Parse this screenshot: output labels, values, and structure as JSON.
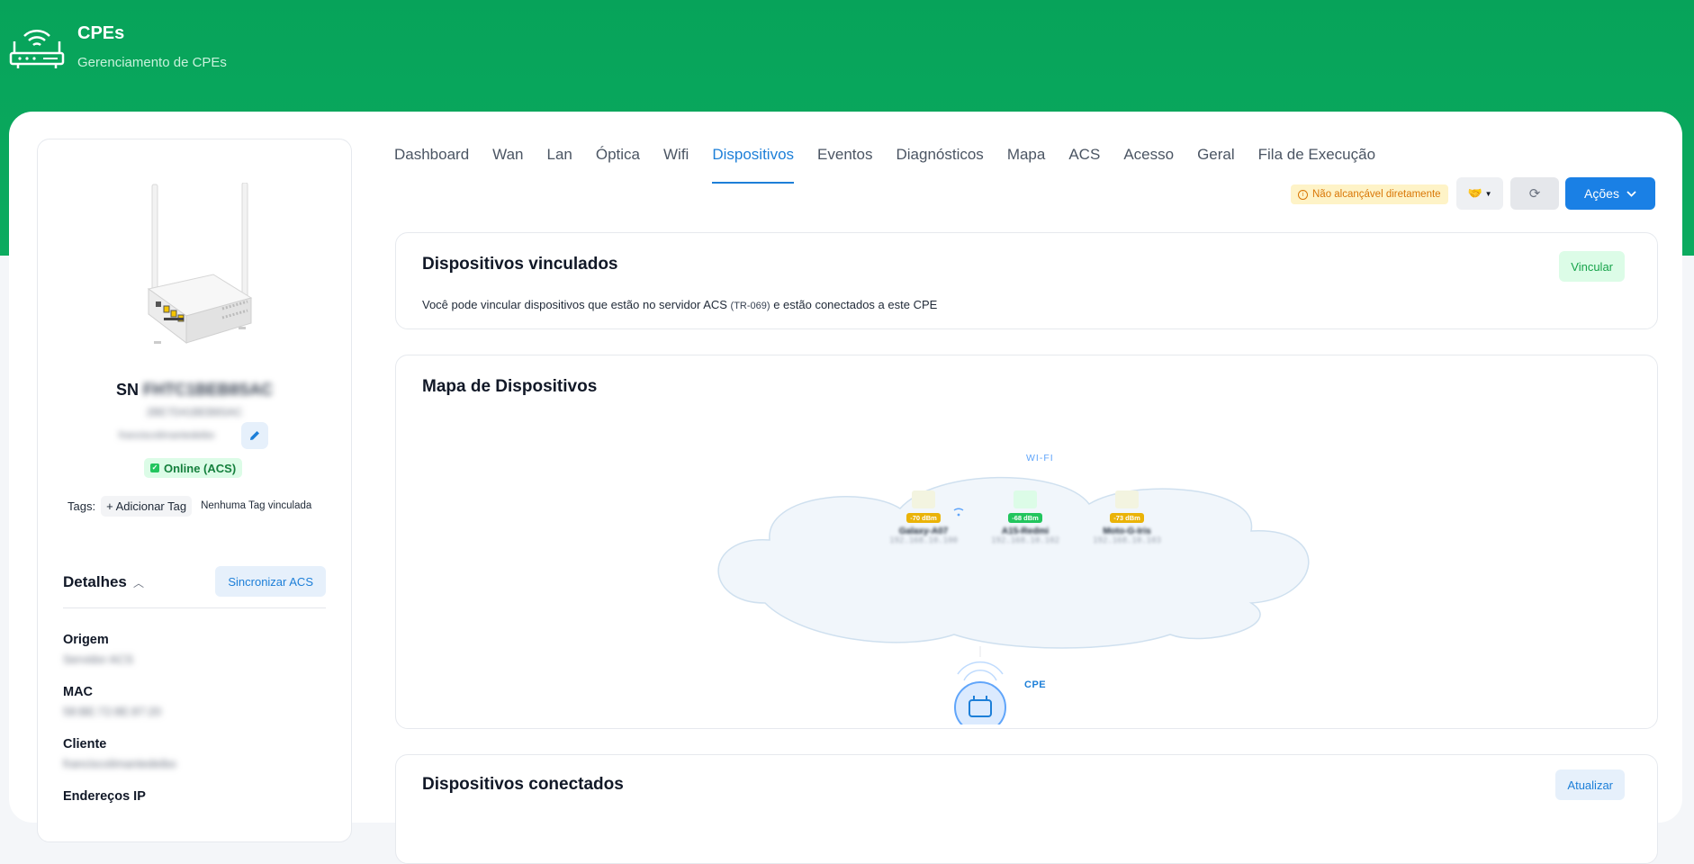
{
  "header": {
    "title": "CPEs",
    "subtitle": "Gerenciamento de CPEs",
    "icon": "router-icon"
  },
  "device": {
    "sn_prefix": "SN",
    "sn_value": "FHTC1BEB8SAC",
    "sn_sub": "2BE7D41BEB8SAC",
    "client_name": "franciscolimantedeibo",
    "status": "Online (ACS)",
    "tags_label": "Tags:",
    "add_tag": "+ Adicionar Tag",
    "no_tag": "Nenhuma Tag vinculada"
  },
  "details": {
    "title": "Detalhes",
    "sync_button": "Sincronizar ACS",
    "items": [
      {
        "label": "Origem",
        "value": "Servidor ACS"
      },
      {
        "label": "MAC",
        "value": "58:BE:72:8E:87:20"
      },
      {
        "label": "Cliente",
        "value": "franciscolimantedeibo"
      },
      {
        "label": "Endereços IP",
        "value": ""
      }
    ]
  },
  "tabs": [
    "Dashboard",
    "Wan",
    "Lan",
    "Óptica",
    "Wifi",
    "Dispositivos",
    "Eventos",
    "Diagnósticos",
    "Mapa",
    "ACS",
    "Acesso",
    "Geral",
    "Fila de Execução"
  ],
  "active_tab": "Dispositivos",
  "toolbar": {
    "unreachable": "Não alcançável diretamente",
    "refresh_icon": "refresh-icon",
    "actions": "Ações"
  },
  "linked": {
    "title": "Dispositivos vinculados",
    "button": "Vincular",
    "desc_before": "Você pode vincular dispositivos que estão no servidor ACS",
    "desc_small": "(TR-069)",
    "desc_after": "e estão conectados a este CPE"
  },
  "map": {
    "title": "Mapa de Dispositivos",
    "wifi_label": "WI-FI",
    "cpe_label": "CPE",
    "devices": [
      {
        "signal": "-70 dBm",
        "name": "Galaxy-A07",
        "ip": "192.168.10.100",
        "color": "#eab308"
      },
      {
        "signal": "-68 dBm",
        "name": "A15-Redmi",
        "ip": "192.168.10.102",
        "color": "#22c55e"
      },
      {
        "signal": "-73 dBm",
        "name": "Moto-G-Iris",
        "ip": "192.168.10.103",
        "color": "#eab308"
      }
    ]
  },
  "connected": {
    "title": "Dispositivos conectados",
    "button": "Atualizar"
  },
  "colors": {
    "brand_green": "#07a35a",
    "accent_blue": "#1a80e5"
  }
}
